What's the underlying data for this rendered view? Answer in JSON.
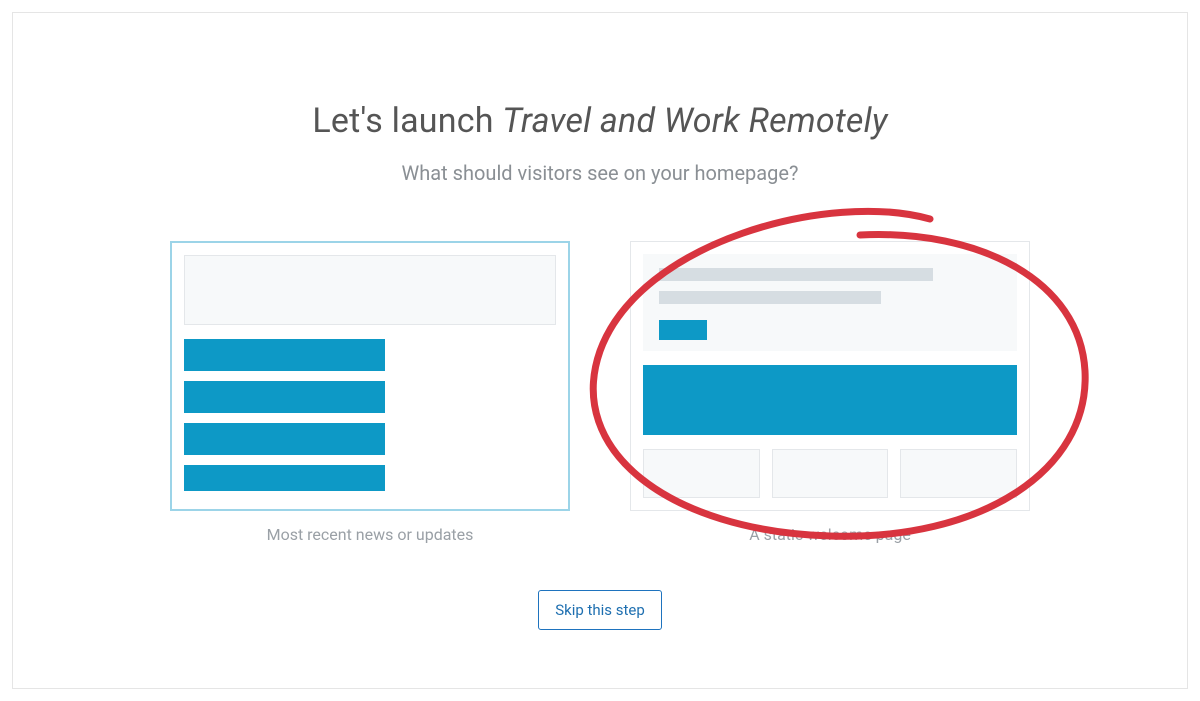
{
  "title_prefix": "Let's launch ",
  "title_site_name": "Travel and Work Remotely",
  "subtitle": "What should visitors see on your homepage?",
  "options": {
    "blog": {
      "caption": "Most recent news or updates",
      "selected": true
    },
    "static": {
      "caption": "A static welcome page",
      "selected": false,
      "annotated_circle": true
    }
  },
  "skip_label": "Skip this step",
  "colors": {
    "accent": "#0d99c6",
    "selected_border": "#9cd4e8",
    "muted_text": "#9aa0a6",
    "annotation": "#d8343f"
  }
}
